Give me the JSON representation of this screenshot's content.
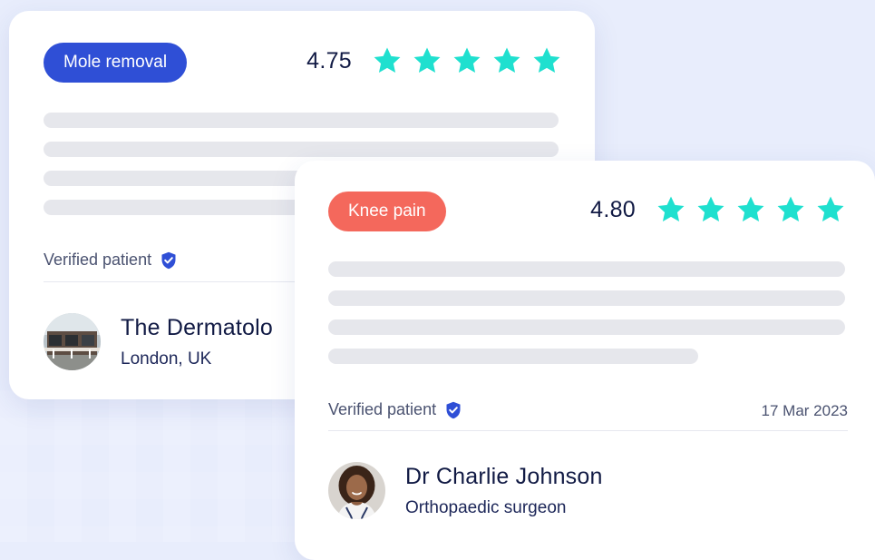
{
  "colors": {
    "background": "#e8edfc",
    "star": "#1fe0cf",
    "tag_blue": "#2f4fd6",
    "tag_coral": "#f4685c",
    "verified_shield": "#2f4fd6"
  },
  "cards": [
    {
      "tag": "Mole removal",
      "rating": "4.75",
      "stars": 5,
      "verified_label": "Verified patient",
      "date": "",
      "name": "The Dermatolo",
      "subtitle": "London, UK",
      "avatar_icon": "clinic-building-photo"
    },
    {
      "tag": "Knee pain",
      "rating": "4.80",
      "stars": 5,
      "verified_label": "Verified patient",
      "date": "17 Mar 2023",
      "name": "Dr Charlie Johnson",
      "subtitle": "Orthopaedic surgeon",
      "avatar_icon": "doctor-portrait-photo"
    }
  ]
}
